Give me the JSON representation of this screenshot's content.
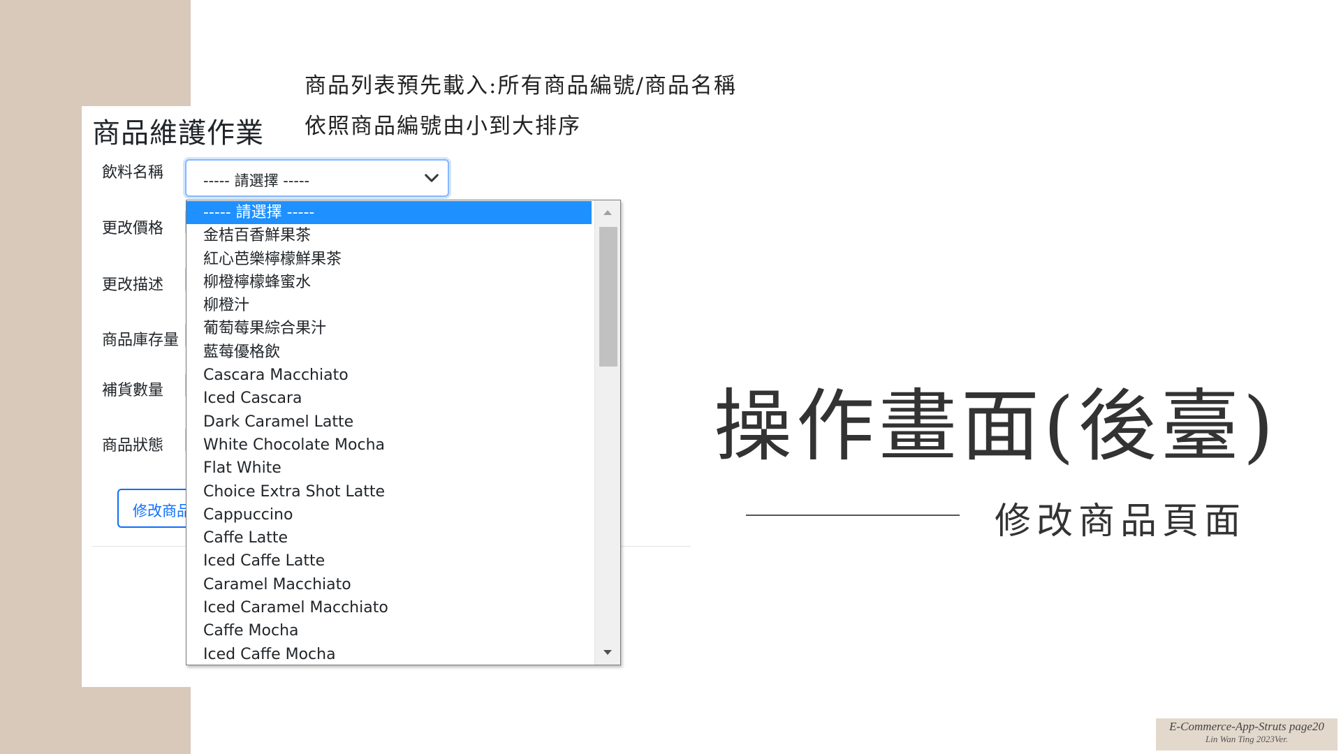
{
  "slide": {
    "note_line1": "商品列表預先載入:所有商品編號/商品名稱",
    "note_line2": "依照商品編號由小到大排序",
    "big_title": "操作畫面(後臺)",
    "sub_title": "修改商品頁面",
    "footer_line1": "E-Commerce-App-Struts page20",
    "footer_line2": "Lin Wan Ting 2023Ver."
  },
  "form": {
    "title": "商品維護作業",
    "labels": {
      "drink_name": "飲料名稱",
      "change_price": "更改價格",
      "change_desc": "更改描述",
      "stock": "商品庫存量",
      "restock": "補貨數量",
      "status": "商品狀態"
    },
    "select_value": "----- 請選擇 -----",
    "submit_label": "修改商品"
  },
  "dropdown": {
    "options": [
      "----- 請選擇 -----",
      "金桔百香鮮果茶",
      "紅心芭樂檸檬鮮果茶",
      "柳橙檸檬蜂蜜水",
      "柳橙汁",
      "葡萄莓果綜合果汁",
      "藍莓優格飲",
      "Cascara Macchiato",
      "Iced Cascara",
      "Dark Caramel Latte",
      "White Chocolate Mocha",
      "Flat White",
      "Choice Extra Shot Latte",
      "Cappuccino",
      "Caffe Latte",
      "Iced Caffe Latte",
      "Caramel Macchiato",
      "Iced Caramel Macchiato",
      "Caffe Mocha",
      "Iced Caffe Mocha"
    ],
    "selected_index": 0
  },
  "colors": {
    "side_band": "#d8c9bb",
    "highlight": "#1e90ff",
    "primary": "#0d6efd"
  }
}
